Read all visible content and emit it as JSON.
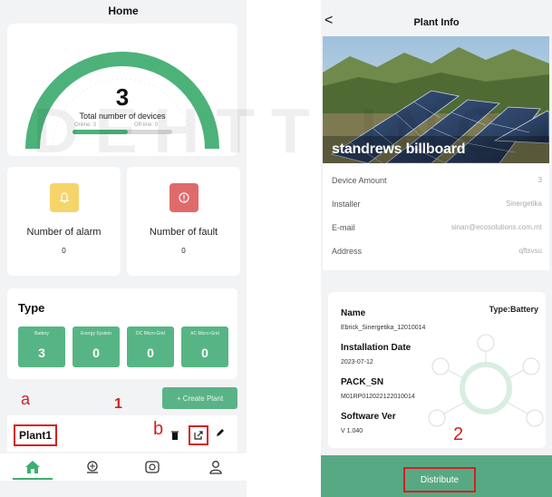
{
  "left_screen": {
    "title": "Home",
    "gauge": {
      "value": "3",
      "label": "Total number of devices",
      "online_label": "Online: 3",
      "offline_label": "Off-line: 0",
      "online_fraction": 1.0
    },
    "alarm": {
      "label": "Number of alarm",
      "value": "0",
      "color": "#f5d46a"
    },
    "fault": {
      "label": "Number of fault",
      "value": "0",
      "color": "#e06a6a"
    },
    "type_section": {
      "title": "Type",
      "tiles": [
        {
          "label": "Battery",
          "value": "3"
        },
        {
          "label": "Energy System",
          "value": "0"
        },
        {
          "label": "DC Micro-Grid",
          "value": "0"
        },
        {
          "label": "AC Micro-Grid",
          "value": "0"
        }
      ]
    },
    "create_plant_label": "+ Create Plant",
    "plant_name": "Plant1",
    "annotations": {
      "a": "a",
      "b": "b",
      "one": "1"
    },
    "tabs": [
      "home-icon",
      "plant-icon",
      "device-icon",
      "user-icon"
    ],
    "accent_color": "#3cb06e"
  },
  "right_screen": {
    "back_label": "<",
    "title": "Plant Info",
    "photo_title": "standrews billboard",
    "info_rows": [
      {
        "key": "Device Amount",
        "value": "3"
      },
      {
        "key": "Installer",
        "value": "Sinergetika"
      },
      {
        "key": "E-mail",
        "value": "sinan@ecosolutions.com.mt"
      },
      {
        "key": "Address",
        "value": "qftsvsu"
      }
    ],
    "device": {
      "type_label": "Type:Battery",
      "name_key": "Name",
      "name_value": "Ebrick_Sinergetika_12010014",
      "install_key": "Installation Date",
      "install_value": "2023-07-12",
      "pack_key": "PACK_SN",
      "pack_value": "M01RP012022122010014",
      "sw_key": "Software Ver",
      "sw_value": "V 1.040"
    },
    "annotation_two": "2",
    "distribute_label": "Distribute",
    "bar_color": "#57a984"
  },
  "watermark_text": "DEHTT INC"
}
